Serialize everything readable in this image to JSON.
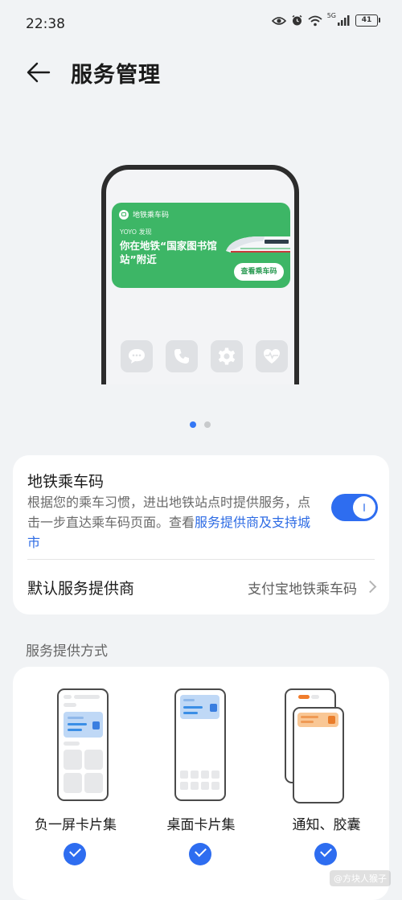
{
  "status_bar": {
    "time": "22:38",
    "network_tag": "5G",
    "battery": "41",
    "icons": [
      "eye-icon",
      "alarm-icon",
      "wifi-icon",
      "signal-icon",
      "battery-icon"
    ]
  },
  "header": {
    "back_icon": "arrow-left-icon",
    "title": "服务管理"
  },
  "preview": {
    "card_title": "地铁乘车码",
    "card_sub": "YOYO 发现",
    "card_headline": "你在地铁“国家图书馆站”附近",
    "card_button": "查看乘车码",
    "apps": [
      "message-icon",
      "phone-icon",
      "settings-icon",
      "health-icon"
    ],
    "pager_total": 2,
    "pager_active": 1
  },
  "metro_setting": {
    "title": "地铁乘车码",
    "description": "根据您的乘车习惯，进出地铁站点时提供服务，点击一步直达乘车码页面。查看",
    "link_text": "服务提供商及支持城市",
    "enabled": true
  },
  "provider_row": {
    "label": "默认服务提供商",
    "value": "支付宝地铁乘车码"
  },
  "section_title": "服务提供方式",
  "methods": [
    {
      "label": "负一屏卡片集",
      "checked": true
    },
    {
      "label": "桌面卡片集",
      "checked": true
    },
    {
      "label": "通知、胶囊",
      "checked": true
    }
  ],
  "watermark": "@方块人猴子",
  "colors": {
    "accent": "#2e6df0",
    "metro_green": "#3db666",
    "background": "#f1f3f5"
  }
}
